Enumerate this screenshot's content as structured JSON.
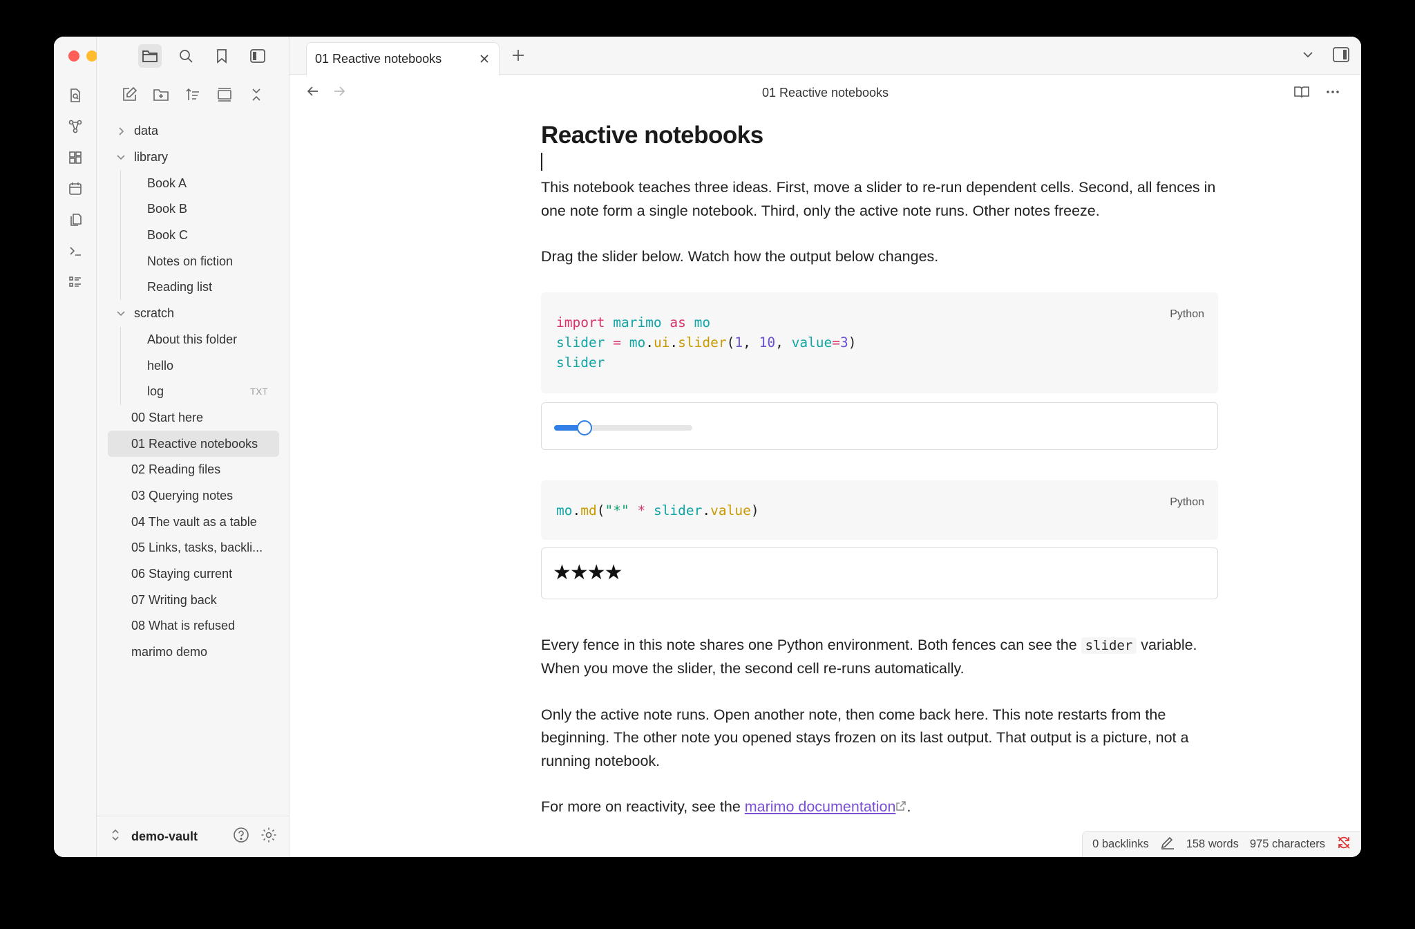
{
  "tab": {
    "title": "01 Reactive notebooks"
  },
  "nav": {
    "title": "01 Reactive notebooks"
  },
  "tree": {
    "data": "data",
    "library": "library",
    "library_items": [
      "Book A",
      "Book B",
      "Book C",
      "Notes on fiction",
      "Reading list"
    ],
    "scratch": "scratch",
    "scratch_items": [
      "About this folder",
      "hello",
      "log"
    ],
    "log_badge": "TXT",
    "root_items": [
      "00 Start here",
      "01 Reactive notebooks",
      "02 Reading files",
      "03 Querying notes",
      "04 The vault as a table",
      "05 Links, tasks, backli...",
      "06 Staying current",
      "07 Writing back",
      "08 What is refused",
      "marimo demo"
    ]
  },
  "vault": {
    "name": "demo-vault"
  },
  "doc": {
    "heading": "Reactive notebooks",
    "p1": "This notebook teaches three ideas. First, move a slider to re-run dependent cells. Second, all fences in one note form a single notebook. Third, only the active note runs. Other notes freeze.",
    "p2": "Drag the slider below. Watch how the output below changes.",
    "lang1": "Python",
    "lang2": "Python",
    "code1": {
      "l1": {
        "kw": "import",
        "mod": "marimo",
        "as": "as",
        "alias": "mo"
      },
      "l2": {
        "var": "slider",
        "eq": "=",
        "mo": "mo",
        "ui": "ui",
        "fn": "slider",
        "a1": "1",
        "a2": "10",
        "kwarg": "value",
        "kwval": "3"
      },
      "l3": "slider"
    },
    "code2": {
      "mo": "mo",
      "fn": "md",
      "str": "\"*\"",
      "op": "*",
      "var": "slider",
      "attr": "value"
    },
    "slider_value": 3,
    "slider_min": 1,
    "slider_max": 10,
    "stars": "★★★★",
    "p3a": "Every fence in this note shares one Python environment. Both fences can see the ",
    "p3code": "slider",
    "p3b": " variable. When you move the slider, the second cell re-runs automatically.",
    "p4": "Only the active note runs. Open another note, then come back here. This note restarts from the beginning. The other note you opened stays frozen on its last output. That output is a picture, not a running notebook.",
    "p5a": "For more on reactivity, see the ",
    "p5link": "marimo documentation",
    "p5b": "."
  },
  "status": {
    "backlinks": "0 backlinks",
    "words": "158 words",
    "chars": "975 characters"
  },
  "colors": {
    "accent": "#2f7fe6",
    "link": "#7b4fd6",
    "close": "#ff5f57",
    "minimize": "#febc2e",
    "zoom": "#28c840"
  }
}
